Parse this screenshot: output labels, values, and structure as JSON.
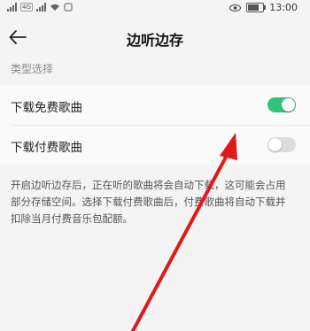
{
  "status_bar": {
    "time": "13:00",
    "network_badge": "4G",
    "battery_level_pct": 75
  },
  "header": {
    "title": "边听边存",
    "back_icon": "arrow-left-icon"
  },
  "section_label": "类型选择",
  "toggles": [
    {
      "label": "下载免费歌曲",
      "on": true
    },
    {
      "label": "下载付费歌曲",
      "on": false
    }
  ],
  "description": "开启边听边存后，正在听的歌曲将会自动下载，这可能会占用部分存储空间。选择下载付费歌曲后，付费歌曲将自动下载并扣除当月付费音乐包配额。",
  "colors": {
    "toggle_on": "#31c27c",
    "toggle_off": "#dcdcdc",
    "annotation_arrow": "#e0191b"
  }
}
